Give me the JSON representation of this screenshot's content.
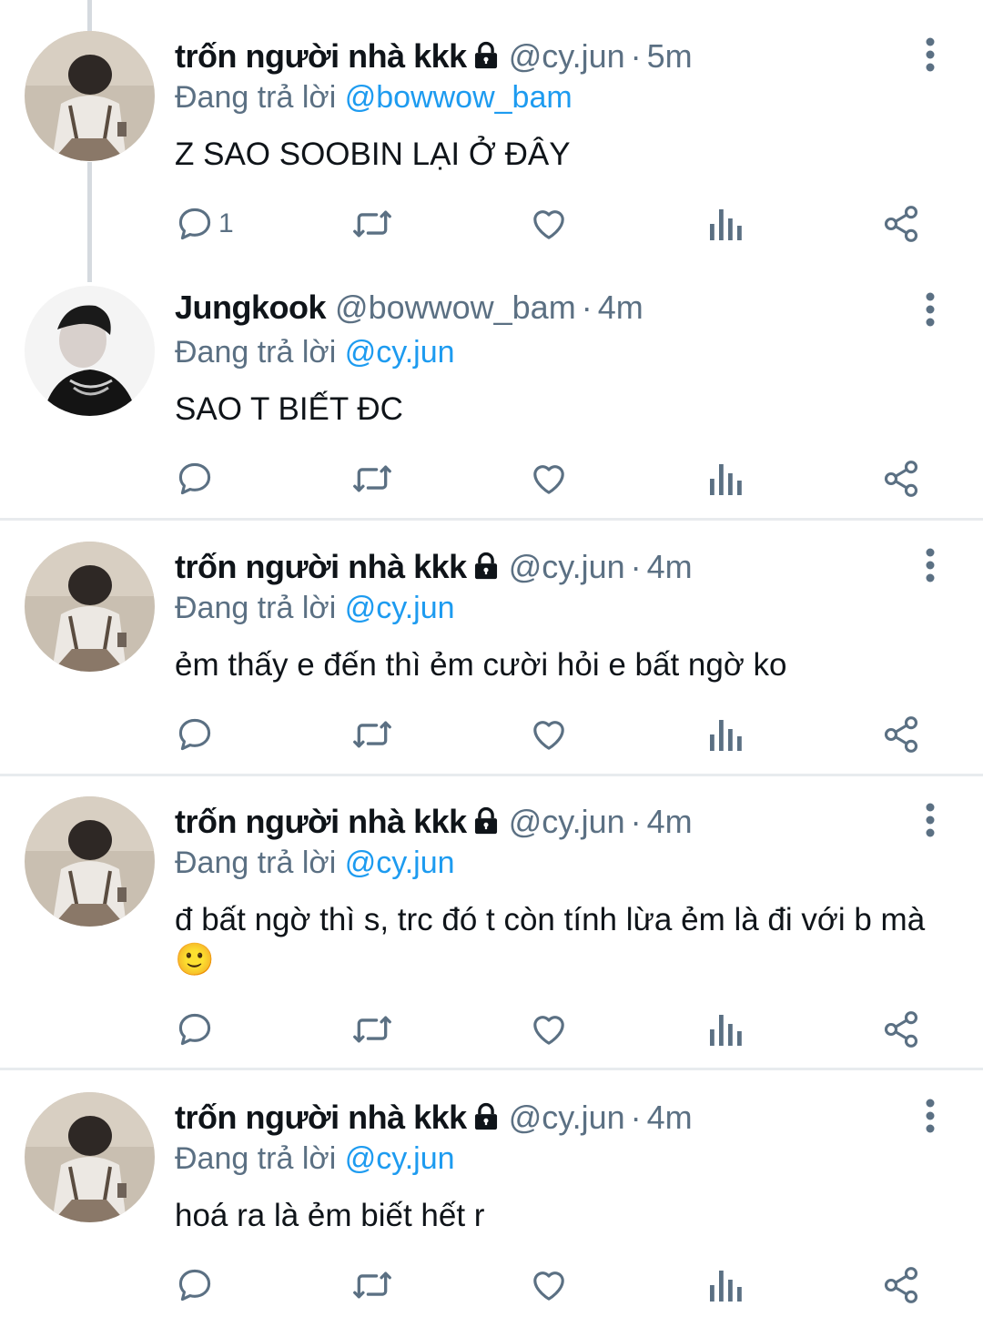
{
  "tweets": [
    {
      "name": "trốn người nhà kkk",
      "handle": "@cy.jun",
      "time": "5m",
      "reply_prefix": "Đang trả lời",
      "reply_to": "@bowwow_bam",
      "text": "Z SAO SOOBIN LẠI Ở ĐÂY",
      "reply_count": "1"
    },
    {
      "name": "Jungkook",
      "handle": "@bowwow_bam",
      "time": "4m",
      "reply_prefix": "Đang trả lời",
      "reply_to": "@cy.jun",
      "text": "SAO T BIẾT ĐC",
      "reply_count": ""
    },
    {
      "name": "trốn người nhà kkk",
      "handle": "@cy.jun",
      "time": "4m",
      "reply_prefix": "Đang trả lời",
      "reply_to": "@cy.jun",
      "text": "ẻm thấy e đến thì ẻm cười hỏi e bất ngờ ko",
      "reply_count": ""
    },
    {
      "name": "trốn người nhà kkk",
      "handle": "@cy.jun",
      "time": "4m",
      "reply_prefix": "Đang trả lời",
      "reply_to": "@cy.jun",
      "text": "đ bất ngờ thì s, trc đó t còn tính lừa ẻm là đi với b mà🙂",
      "reply_count": ""
    },
    {
      "name": "trốn người nhà kkk",
      "handle": "@cy.jun",
      "time": "4m",
      "reply_prefix": "Đang trả lời",
      "reply_to": "@cy.jun",
      "text": "hoá ra là ẻm biết hết r",
      "reply_count": ""
    }
  ],
  "colors": {
    "text": "#0f1419",
    "secondary": "#5b7083",
    "mention": "#1d9bf0",
    "divider": "#e8ebee",
    "thread_line": "#d5dadf"
  },
  "icons": {
    "locked": "lock-icon",
    "more": "more-vertical-icon",
    "reply": "reply-bubble-icon",
    "retweet": "retweet-icon",
    "like": "heart-icon",
    "analytics": "analytics-icon",
    "share": "share-icon"
  }
}
